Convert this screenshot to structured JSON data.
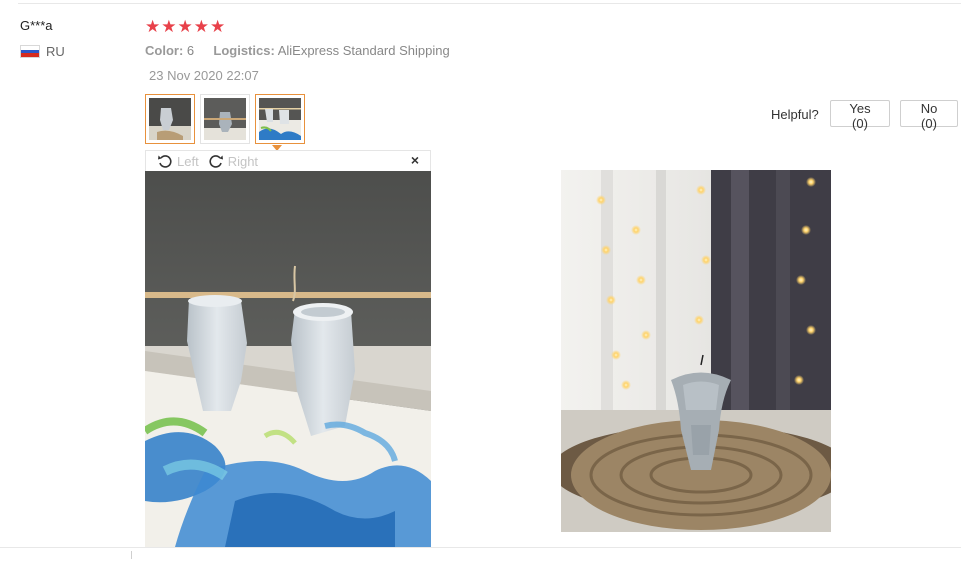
{
  "review": {
    "user": "G***a",
    "country": "RU",
    "rating": 5,
    "rating_stars": [
      "★",
      "★",
      "★",
      "★",
      "★"
    ],
    "color_label": "Color:",
    "color_value": "6",
    "logistics_label": "Logistics:",
    "logistics_value": "AliExpress Standard Shipping",
    "date": "23 Nov 2020 22:07",
    "selected_thumbnail": 3
  },
  "helpful": {
    "label": "Helpful?",
    "yes": "Yes (0)",
    "no": "No (0)"
  },
  "viewer": {
    "rotate_left": "Left",
    "rotate_right": "Right",
    "close": "×"
  },
  "colors": {
    "star": "#e8414a",
    "active_border": "#e8913c",
    "muted_text": "#999999"
  },
  "icons": [
    "rotate-left-icon",
    "rotate-right-icon",
    "close-icon",
    "russia-flag-icon",
    "star-icon"
  ]
}
